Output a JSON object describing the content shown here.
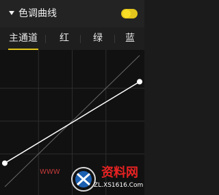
{
  "panel": {
    "title": "色调曲线",
    "enabled": true
  },
  "tabs": [
    {
      "label": "主通道",
      "active": true
    },
    {
      "label": "红",
      "active": false
    },
    {
      "label": "绿",
      "active": false
    },
    {
      "label": "蓝",
      "active": false
    }
  ],
  "curve": {
    "points": [
      {
        "input": 0,
        "output": 0.18
      },
      {
        "input": 1,
        "output": 0.8
      }
    ],
    "grid_divisions": 4
  },
  "watermark": {
    "brand": "资料网",
    "url": "ZL.XS1616.Com",
    "small": "WWW"
  },
  "colors": {
    "accent": "#e3c51c",
    "background": "#111111",
    "grid": "#2d2d2d",
    "diagonal": "#6a6a6a",
    "curve": "#ffffff"
  }
}
